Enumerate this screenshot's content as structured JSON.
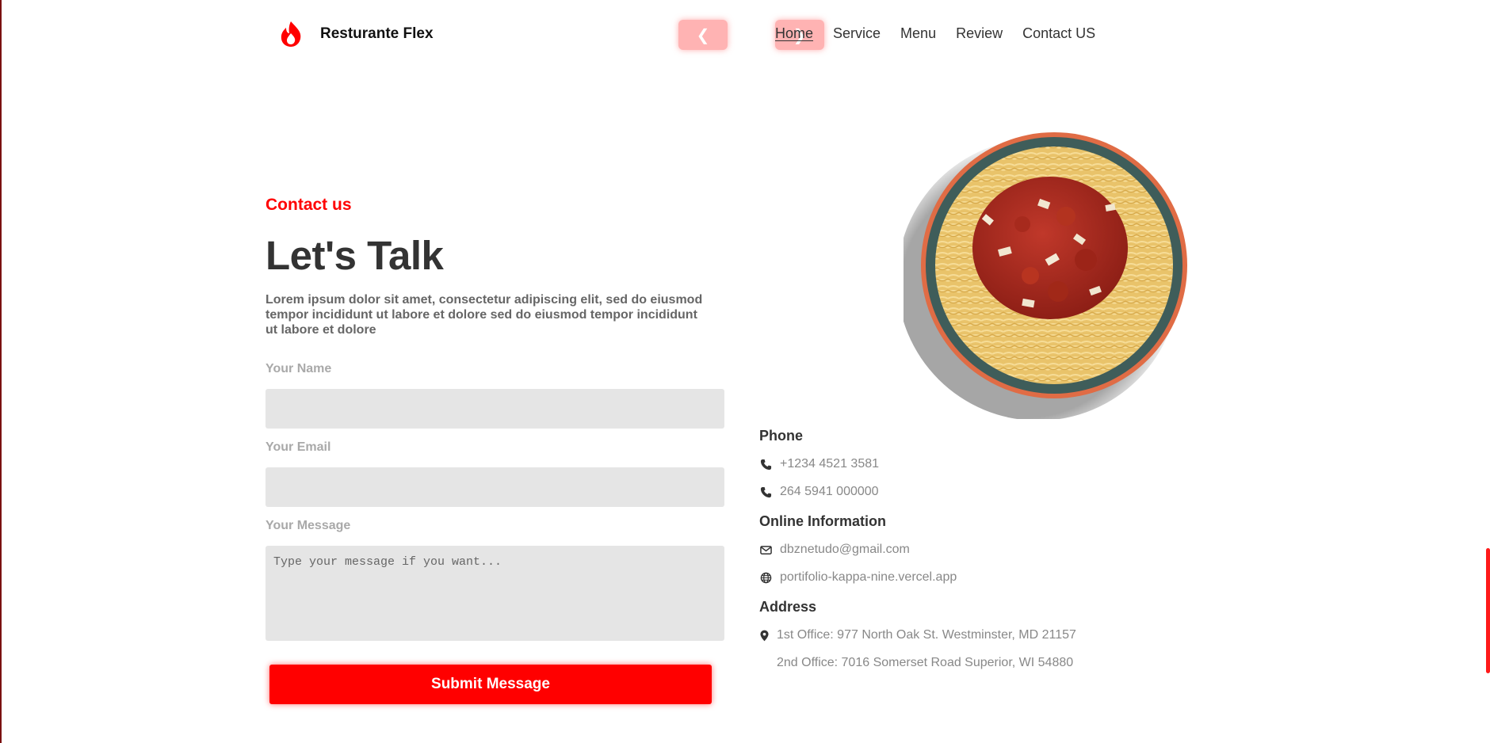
{
  "brand": {
    "name": "Resturante Flex",
    "logo_icon": "flame-icon",
    "accent_color": "#ff0000"
  },
  "carousel": {
    "prev_label": "❮",
    "next_label": "❯"
  },
  "nav": {
    "items": [
      {
        "label": "Home",
        "active": true
      },
      {
        "label": "Service",
        "active": false
      },
      {
        "label": "Menu",
        "active": false
      },
      {
        "label": "Review",
        "active": false
      },
      {
        "label": "Contact US",
        "active": false
      }
    ]
  },
  "contact": {
    "eyebrow": "Contact us",
    "headline": "Let's Talk",
    "intro": "Lorem ipsum dolor sit amet, consectetur adipiscing elit, sed do eiusmod tempor incididunt ut labore et dolore sed do eiusmod tempor incididunt ut labore et dolore",
    "form": {
      "name_label": "Your Name",
      "name_value": "",
      "email_label": "Your Email",
      "email_value": "",
      "message_label": "Your Message",
      "message_placeholder": "Type your message if you want...",
      "submit_label": "Submit Message"
    }
  },
  "info": {
    "phone_heading": "Phone",
    "phones": [
      "+1234 4521 3581",
      "264 5941 000000"
    ],
    "online_heading": "Online Information",
    "email": "dbznetudo@gmail.com",
    "website": "portifolio-kappa-nine.vercel.app",
    "address_heading": "Address",
    "office_1": "1st Office: 977 North Oak St. Westminster, MD 21157",
    "office_2": "2nd Office: 7016 Somerset Road Superior, WI 54880"
  },
  "icons": {
    "phone": "phone-icon",
    "email": "envelope-icon",
    "web": "globe-icon",
    "address": "map-pin-icon"
  }
}
